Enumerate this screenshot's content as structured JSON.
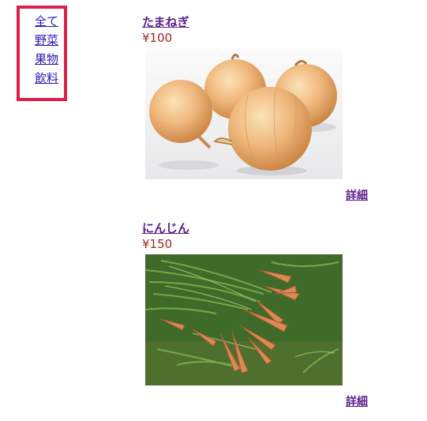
{
  "categories": [
    "全て",
    "野菜",
    "果物",
    "飲料"
  ],
  "products": [
    {
      "name": "たまねぎ",
      "price": "¥100",
      "detail": "詳細",
      "image": "onion-photo"
    },
    {
      "name": "にんじん",
      "price": "¥150",
      "detail": "詳細",
      "image": "carrot-photo"
    }
  ]
}
